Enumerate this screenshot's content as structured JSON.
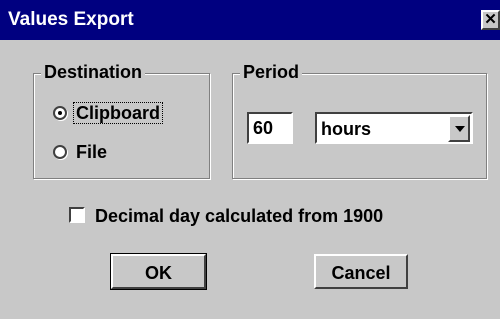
{
  "window": {
    "title": "Values Export",
    "close_symbol": "✕"
  },
  "destination": {
    "legend": "Destination",
    "options": [
      {
        "label": "Clipboard",
        "selected": true
      },
      {
        "label": "File",
        "selected": false
      }
    ]
  },
  "period": {
    "legend": "Period",
    "value": "60",
    "unit": "hours"
  },
  "decimal_day": {
    "label": "Decimal day calculated from 1900",
    "checked": false
  },
  "buttons": {
    "ok": "OK",
    "cancel": "Cancel"
  },
  "icons": {
    "close": "close-icon",
    "dropdown": "chevron-down-icon"
  },
  "colors": {
    "titlebar": "#000080",
    "dialog_bg": "#c8c8c8"
  }
}
